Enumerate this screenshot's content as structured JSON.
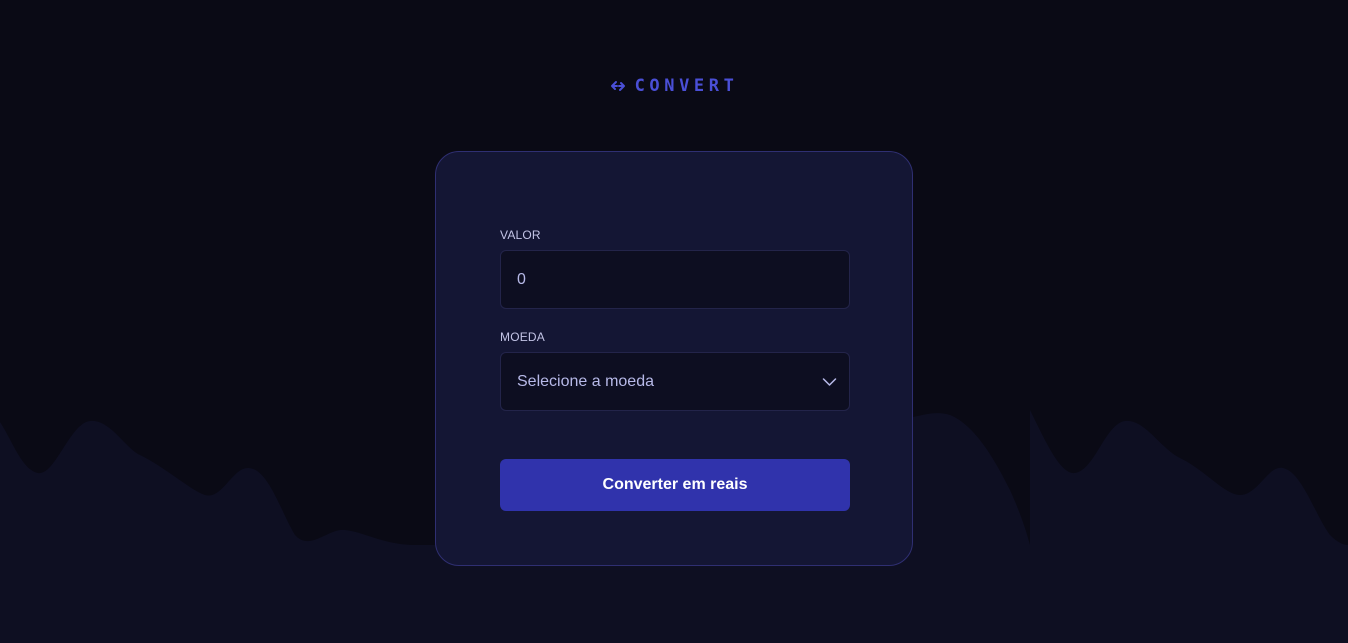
{
  "brand": {
    "name": "CONVERT",
    "icon": "arrows-convert-icon",
    "color": "#4a4fd6"
  },
  "form": {
    "amount_label": "VALOR",
    "amount_value": "0",
    "currency_label": "MOEDA",
    "currency_selected": "Selecione a moeda",
    "submit_label": "Converter em reais"
  },
  "colors": {
    "background": "#0a0a15",
    "card": "#141634",
    "card_border": "#2f2f72",
    "input_bg": "#0d0e21",
    "button": "#3033ac"
  }
}
